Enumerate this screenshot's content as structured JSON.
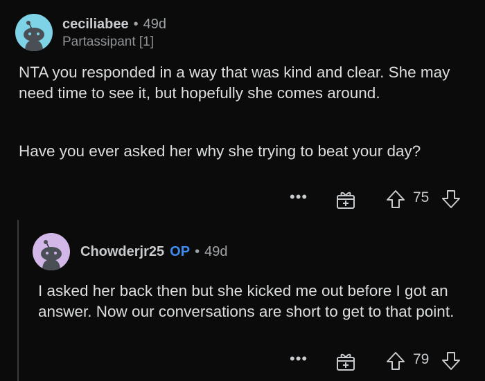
{
  "comments": [
    {
      "username": "ceciliabee",
      "age": "49d",
      "flair": "Partassipant [1]",
      "paragraphs": [
        "NTA you responded in a way that was kind and clear. She may need time to see it, but hopefully she comes around.",
        "Have you ever asked her why she trying to beat your day?"
      ],
      "score": "75",
      "avatar_color": "#7ed3e6"
    },
    {
      "username": "Chowderjr25",
      "op_badge": "OP",
      "age": "49d",
      "paragraphs": [
        "I asked her back then but she kicked me out before I got an answer. Now our conversations are short to get to that point."
      ],
      "score": "79",
      "avatar_color": "#d2b7e8"
    }
  ],
  "ui": {
    "separator": "•",
    "more": "•••",
    "icons": [
      "more-options-icon",
      "award-icon",
      "upvote-icon",
      "downvote-icon"
    ]
  }
}
